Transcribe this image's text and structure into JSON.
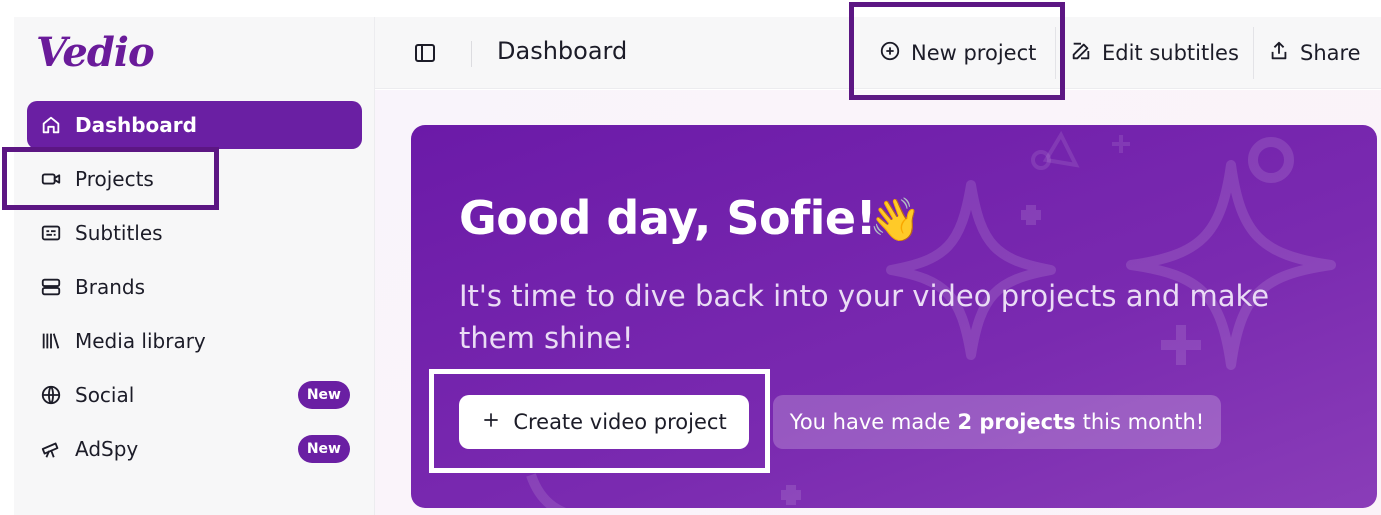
{
  "app": {
    "logo_text": "Vedio",
    "brand_color": "#6a1fa3"
  },
  "sidebar": {
    "items": [
      {
        "label": "Dashboard",
        "icon": "home-icon",
        "active": true
      },
      {
        "label": "Projects",
        "icon": "video-camera-icon"
      },
      {
        "label": "Subtitles",
        "icon": "subtitles-icon"
      },
      {
        "label": "Brands",
        "icon": "brands-icon"
      },
      {
        "label": "Media library",
        "icon": "library-icon"
      },
      {
        "label": "Social",
        "icon": "globe-icon",
        "badge": "New"
      },
      {
        "label": "AdSpy",
        "icon": "telescope-icon",
        "badge": "New"
      }
    ]
  },
  "header": {
    "title": "Dashboard",
    "new_project_label": "New project",
    "edit_subtitles_label": "Edit subtitles",
    "share_label": "Share"
  },
  "hero": {
    "greeting": "Good day, Sofie!",
    "emoji": "👋",
    "subtitle": "It's time to dive back into your video projects and make them shine!",
    "create_label": "Create video project",
    "stat_prefix": "You have made",
    "stat_value": "2 projects",
    "stat_suffix": "this month!"
  }
}
